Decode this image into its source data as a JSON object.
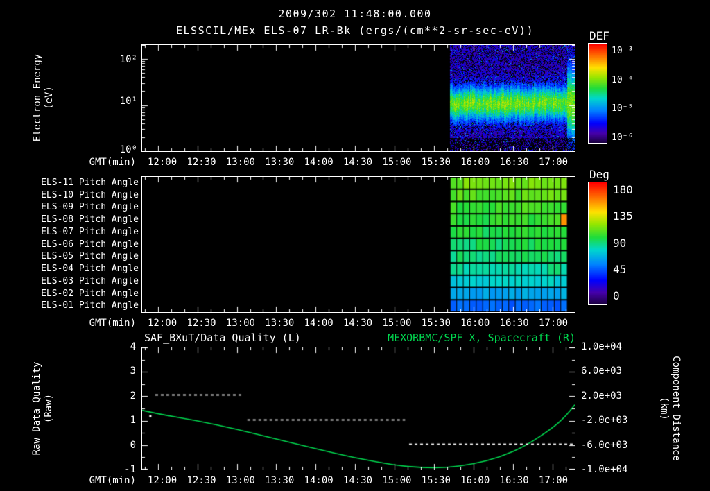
{
  "colors": {
    "background": "#000000",
    "foreground": "#ffffff",
    "accent_green": "#00d84f"
  },
  "title": {
    "line1": "2009/302 11:48:00.000",
    "line2": "ELSSCIL/MEx ELS-07 LR-Bk  (ergs/(cm**2-sr-sec-eV))"
  },
  "time_axis": {
    "label": "GMT(min)",
    "start": "11:48",
    "end": "17:17",
    "ticks": [
      "12:00",
      "12:30",
      "13:00",
      "13:30",
      "14:00",
      "14:30",
      "15:00",
      "15:30",
      "16:00",
      "16:30",
      "17:00"
    ]
  },
  "panels": {
    "spectrogram": {
      "y_label": "Electron Energy",
      "y_unit": "(eV)",
      "y_ticks": [
        "10²",
        "10¹",
        "10⁰"
      ],
      "colorbar_title": "DEF",
      "colorbar_ticks": [
        "10⁻³",
        "10⁻⁴",
        "10⁻⁵",
        "10⁻⁶"
      ]
    },
    "pitch": {
      "row_labels": [
        "ELS-11 Pitch Angle",
        "ELS-10 Pitch Angle",
        "ELS-09 Pitch Angle",
        "ELS-08 Pitch Angle",
        "ELS-07 Pitch Angle",
        "ELS-06 Pitch Angle",
        "ELS-05 Pitch Angle",
        "ELS-04 Pitch Angle",
        "ELS-03 Pitch Angle",
        "ELS-02 Pitch Angle",
        "ELS-01 Pitch Angle"
      ],
      "colorbar_title": "Deg",
      "colorbar_ticks": [
        "180",
        "135",
        "90",
        "45",
        "0"
      ]
    },
    "timeseries": {
      "title_left": "SAF_BXuT/Data Quality (L)",
      "title_right": "MEXORBMC/SPF X, Spacecraft (R)",
      "left_label": "Raw Data Quality",
      "left_unit": "(Raw)",
      "left_ticks": [
        "4",
        "3",
        "2",
        "1",
        "0",
        "-1"
      ],
      "right_label": "Component Distance",
      "right_unit": "(km)",
      "right_ticks": [
        "1.0e+04",
        "6.0e+03",
        "2.0e+03",
        "-2.0e+03",
        "-6.0e+03",
        "-1.0e+04"
      ]
    }
  },
  "chart_data": [
    {
      "type": "heatmap",
      "panel": "electron-energy-spectrogram",
      "title": "ELSSCIL/MEx ELS-07 LR-Bk",
      "units_label": "ergs/(cm**2-sr-sec-eV)",
      "xlabel": "GMT(min)",
      "ylabel": "Electron Energy (eV)",
      "x_range": [
        "11:48",
        "17:17"
      ],
      "y_scale": "log",
      "y_range_eV": [
        1,
        200
      ],
      "y_ticks": [
        "10²",
        "10¹",
        "10⁰"
      ],
      "z_label": "DEF",
      "z_ticks_log10_flux": [
        -3,
        -4,
        -5,
        -6
      ],
      "colormap": "rainbow",
      "data_start": "15:42",
      "data_end": "17:17",
      "band_center_eV": 11,
      "band_sigma_log10": 0.24,
      "band_level": 0.48,
      "background_level": 0.14,
      "right_edge_blob": true
    },
    {
      "type": "heatmap",
      "panel": "pitch-angle-grid",
      "rows": [
        "ELS-11",
        "ELS-10",
        "ELS-09",
        "ELS-08",
        "ELS-07",
        "ELS-06",
        "ELS-05",
        "ELS-04",
        "ELS-03",
        "ELS-02",
        "ELS-01"
      ],
      "row_mean_pitch_deg": [
        112,
        107,
        103,
        100,
        97,
        94,
        91,
        86,
        78,
        66,
        52
      ],
      "z_label": "Deg",
      "z_range": [
        0,
        180
      ],
      "z_ticks": [
        180,
        135,
        90,
        45,
        0
      ],
      "colormap": "rainbow",
      "data_start": "15:42",
      "data_end": "17:11",
      "columns": 18,
      "hot_cell": {
        "row": "ELS-08",
        "column_index": 17,
        "value_deg": 152
      }
    },
    {
      "type": "line",
      "panel": "quality-and-spacecraft-position",
      "title_left": "SAF_BXuT/Data Quality (L)",
      "title_right": "MEXORBMC/SPF X, Spacecraft (R)",
      "x_range": [
        "11:48",
        "17:17"
      ],
      "left_axis": {
        "label": "Raw Data Quality (Raw)",
        "range": [
          -1,
          4
        ],
        "ticks": [
          4,
          3,
          2,
          1,
          0,
          -1
        ]
      },
      "right_axis": {
        "label": "Component Distance (km)",
        "range": [
          -10000,
          10000
        ],
        "ticks": [
          10000,
          6000,
          2000,
          -2000,
          -6000,
          -10000
        ]
      },
      "series": [
        {
          "name": "SAF_BXuT/Data Quality",
          "axis": "left",
          "style": "dashed",
          "color": "#ffffff",
          "segments": [
            {
              "start": "11:58",
              "end": "13:05",
              "value": 2
            },
            {
              "start": "13:08",
              "end": "15:08",
              "value": 1
            },
            {
              "start": "15:11",
              "end": "17:16",
              "value": 0
            }
          ],
          "isolated_points": [
            {
              "x": "11:54",
              "value": 1.2
            }
          ]
        },
        {
          "name": "MEXORBMC/SPF X Spacecraft",
          "axis": "right",
          "style": "solid",
          "color": "#00d84f",
          "x": [
            "11:48",
            "12:00",
            "12:30",
            "13:00",
            "13:30",
            "14:00",
            "14:30",
            "15:00",
            "15:20",
            "15:40",
            "16:00",
            "16:20",
            "16:40",
            "17:00",
            "17:10",
            "17:17"
          ],
          "y_km": [
            -300,
            -900,
            -2000,
            -3400,
            -5000,
            -6600,
            -8100,
            -9300,
            -9700,
            -9700,
            -9100,
            -8000,
            -6100,
            -3200,
            -1300,
            600
          ]
        }
      ]
    }
  ]
}
